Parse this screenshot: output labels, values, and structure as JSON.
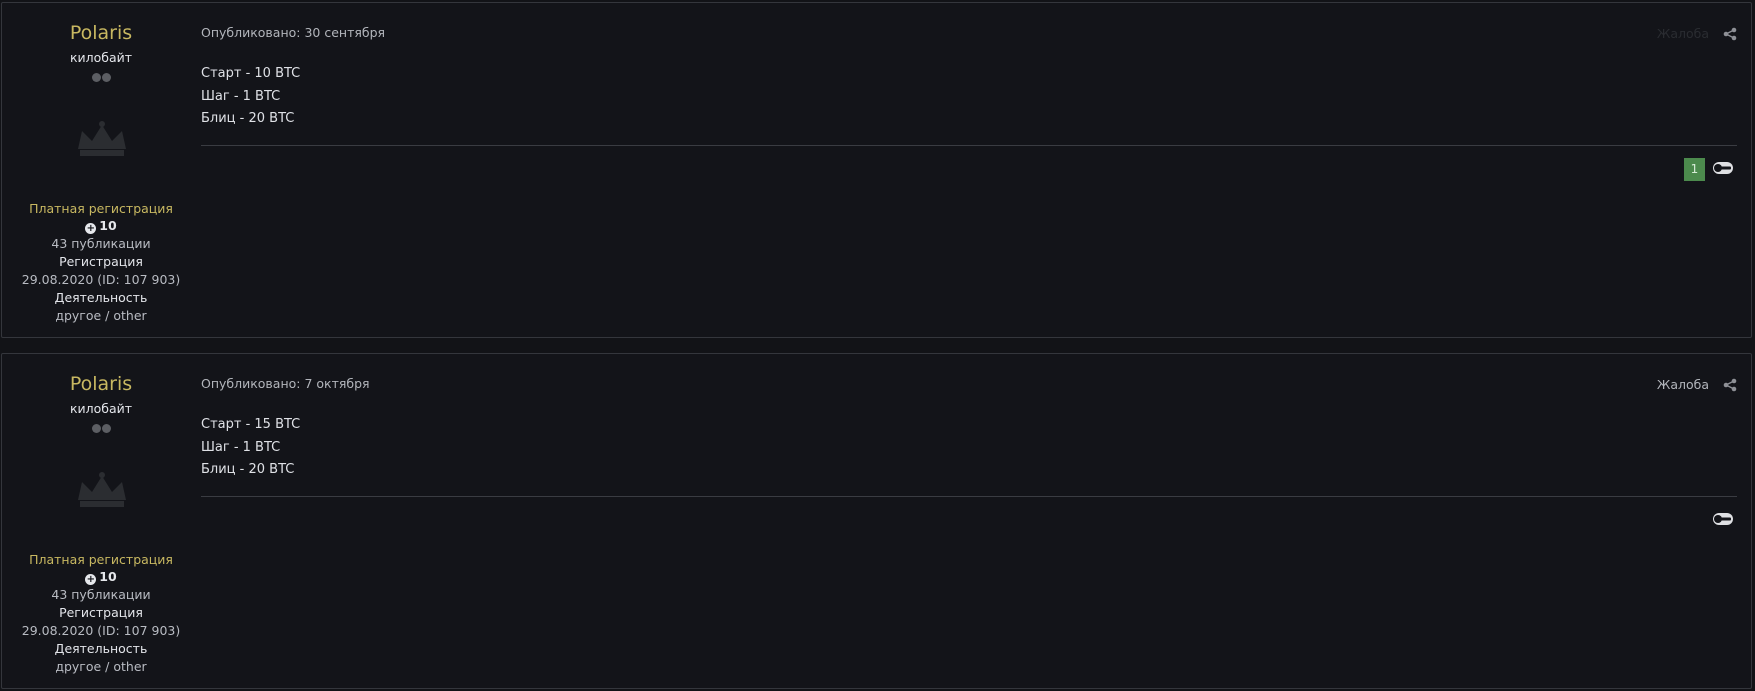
{
  "posts": [
    {
      "author": {
        "name": "Polaris",
        "rank": "килобайт",
        "group": "Платная регистрация",
        "reputation": "10",
        "posts_count": "43 публикации",
        "reg_label": "Регистрация",
        "reg_value": "29.08.2020 (ID: 107 903)",
        "activity_label": "Деятельность",
        "activity_value": "другое / other"
      },
      "published": "Опубликовано: 30 сентября",
      "report_label": "Жалоба",
      "lines": [
        "Старт - 10 BTC",
        "Шаг - 1 BTC",
        "Блиц - 20 BTC"
      ],
      "reaction_count": "1"
    },
    {
      "author": {
        "name": "Polaris",
        "rank": "килобайт",
        "group": "Платная регистрация",
        "reputation": "10",
        "posts_count": "43 публикации",
        "reg_label": "Регистрация",
        "reg_value": "29.08.2020 (ID: 107 903)",
        "activity_label": "Деятельность",
        "activity_value": "другое / other"
      },
      "published": "Опубликовано: 7 октября",
      "report_label": "Жалоба",
      "lines": [
        "Старт - 15 BTC",
        "Шаг - 1 BTC",
        "Блиц - 20 BTC"
      ]
    }
  ],
  "icons": {
    "rank_pips": "rank-pips-icon",
    "crown": "crown-icon",
    "reputation": "plus-circle-icon",
    "share": "share-icon",
    "reaction": "reaction-icon"
  },
  "colors": {
    "background": "#121317",
    "author_name": "#c8b861",
    "reaction_badge": "#4c8a4d"
  }
}
